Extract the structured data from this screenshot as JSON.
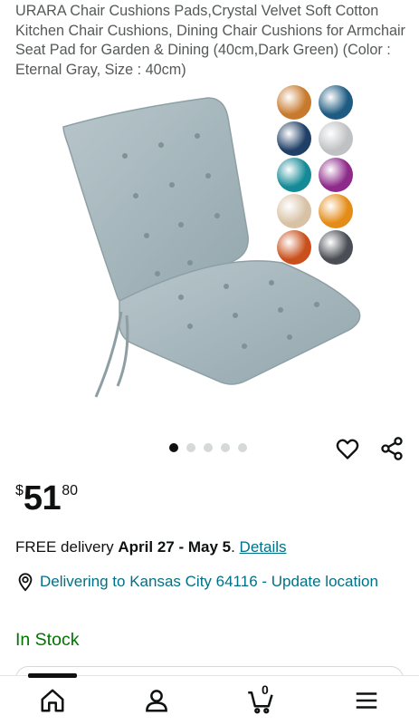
{
  "product": {
    "title": "URARA Chair Cushions Pads,Crystal Velvet Soft Cotton Kitchen Chair Cushions, Dining Chair Cushions for Armchair Seat Pad for Garden & Dining (40cm,Dark Green) (Color : Eternal Gray, Size : 40cm)",
    "color_swatches": [
      "#c77a2d",
      "#1e5b82",
      "#1f3f66",
      "#bfc1c3",
      "#148a96",
      "#8d2a8a",
      "#d8c2a6",
      "#e48c18",
      "#c9501c",
      "#4a4e54"
    ]
  },
  "gallery": {
    "image_count": 5,
    "active_index": 0
  },
  "price": {
    "symbol": "$",
    "whole": "51",
    "fraction": "80"
  },
  "delivery": {
    "prefix": "FREE delivery ",
    "dates": "April 27 - May 5",
    "suffix": ". ",
    "details_link": "Details"
  },
  "location": {
    "text": "Delivering to Kansas City 64116 - Update location"
  },
  "stock": {
    "status": "In Stock"
  },
  "nav": {
    "cart_count": "0"
  },
  "icons": {
    "wishlist": "heart-icon",
    "share": "share-icon",
    "location": "location-pin-icon",
    "home": "home-icon",
    "account": "person-icon",
    "cart": "cart-icon",
    "menu": "menu-icon"
  },
  "colors": {
    "link": "#007185",
    "in_stock": "#007600",
    "text": "#0f1111",
    "muted": "#565959"
  }
}
